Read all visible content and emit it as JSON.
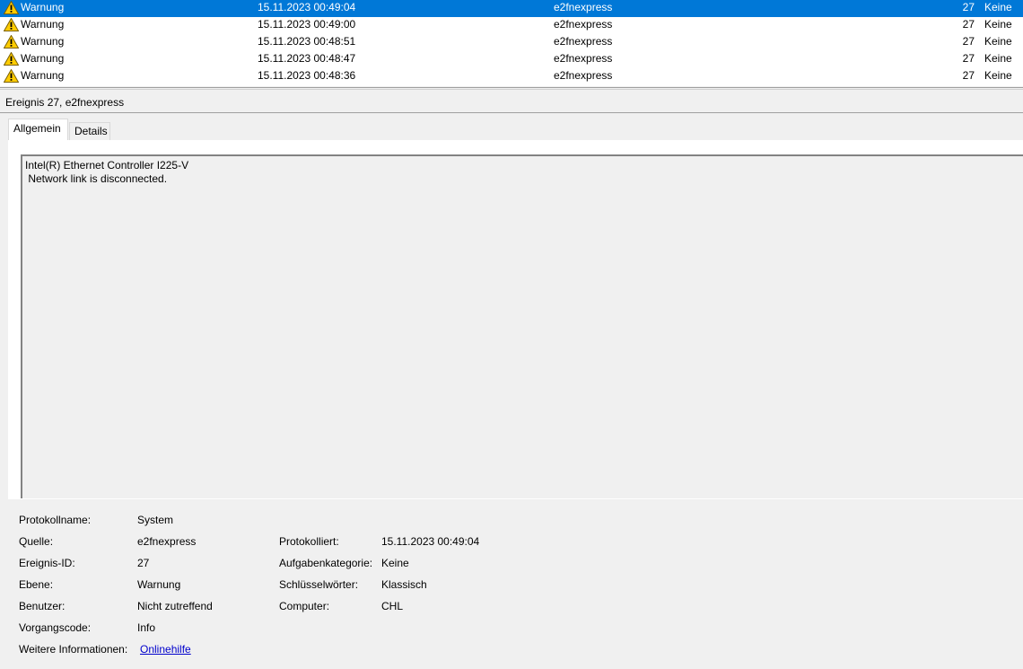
{
  "events": [
    {
      "level": "Warnung",
      "date": "15.11.2023 00:49:04",
      "source": "e2fnexpress",
      "id": "27",
      "category": "Keine",
      "selected": true
    },
    {
      "level": "Warnung",
      "date": "15.11.2023 00:49:00",
      "source": "e2fnexpress",
      "id": "27",
      "category": "Keine",
      "selected": false
    },
    {
      "level": "Warnung",
      "date": "15.11.2023 00:48:51",
      "source": "e2fnexpress",
      "id": "27",
      "category": "Keine",
      "selected": false
    },
    {
      "level": "Warnung",
      "date": "15.11.2023 00:48:47",
      "source": "e2fnexpress",
      "id": "27",
      "category": "Keine",
      "selected": false
    },
    {
      "level": "Warnung",
      "date": "15.11.2023 00:48:36",
      "source": "e2fnexpress",
      "id": "27",
      "category": "Keine",
      "selected": false
    }
  ],
  "event_header": "Ereignis 27, e2fnexpress",
  "tabs": {
    "general": "Allgemein",
    "details": "Details"
  },
  "message": {
    "line1": "Intel(R) Ethernet Controller I225-V",
    "line2": " Network link is disconnected."
  },
  "properties": {
    "log_name_label": "Protokollname:",
    "log_name_value": "System",
    "source_label": "Quelle:",
    "source_value": "e2fnexpress",
    "event_id_label": "Ereignis-ID:",
    "event_id_value": "27",
    "level_label": "Ebene:",
    "level_value": "Warnung",
    "user_label": "Benutzer:",
    "user_value": "Nicht zutreffend",
    "opcode_label": "Vorgangscode:",
    "opcode_value": "Info",
    "more_info_label": "Weitere Informationen:",
    "more_info_link": "Onlinehilfe",
    "logged_label": "Protokolliert:",
    "logged_value": "15.11.2023 00:49:04",
    "task_category_label": "Aufgabenkategorie:",
    "task_category_value": "Keine",
    "keywords_label": "Schlüsselwörter:",
    "keywords_value": "Klassisch",
    "computer_label": "Computer:",
    "computer_value": "CHL"
  }
}
